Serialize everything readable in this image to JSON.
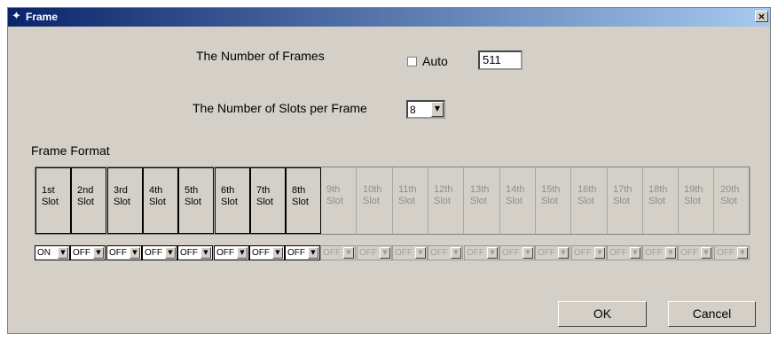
{
  "window": {
    "title": "Frame",
    "close_glyph": "×"
  },
  "frames": {
    "label": "The Number of Frames",
    "auto_label": "Auto",
    "auto_checked": false,
    "value": "511"
  },
  "slots_per_frame": {
    "label": "The Number of Slots per Frame",
    "value": "8"
  },
  "frame_format": {
    "label": "Frame Format",
    "slots": [
      {
        "ordinal": "1st",
        "word": "Slot",
        "enabled": true,
        "state": "ON"
      },
      {
        "ordinal": "2nd",
        "word": "Slot",
        "enabled": true,
        "state": "OFF"
      },
      {
        "ordinal": "3rd",
        "word": "Slot",
        "enabled": true,
        "state": "OFF"
      },
      {
        "ordinal": "4th",
        "word": "Slot",
        "enabled": true,
        "state": "OFF"
      },
      {
        "ordinal": "5th",
        "word": "Slot",
        "enabled": true,
        "state": "OFF"
      },
      {
        "ordinal": "6th",
        "word": "Slot",
        "enabled": true,
        "state": "OFF"
      },
      {
        "ordinal": "7th",
        "word": "Slot",
        "enabled": true,
        "state": "OFF"
      },
      {
        "ordinal": "8th",
        "word": "Slot",
        "enabled": true,
        "state": "OFF"
      },
      {
        "ordinal": "9th",
        "word": "Slot",
        "enabled": false,
        "state": "OFF"
      },
      {
        "ordinal": "10th",
        "word": "Slot",
        "enabled": false,
        "state": "OFF"
      },
      {
        "ordinal": "11th",
        "word": "Slot",
        "enabled": false,
        "state": "OFF"
      },
      {
        "ordinal": "12th",
        "word": "Slot",
        "enabled": false,
        "state": "OFF"
      },
      {
        "ordinal": "13th",
        "word": "Slot",
        "enabled": false,
        "state": "OFF"
      },
      {
        "ordinal": "14th",
        "word": "Slot",
        "enabled": false,
        "state": "OFF"
      },
      {
        "ordinal": "15th",
        "word": "Slot",
        "enabled": false,
        "state": "OFF"
      },
      {
        "ordinal": "16th",
        "word": "Slot",
        "enabled": false,
        "state": "OFF"
      },
      {
        "ordinal": "17th",
        "word": "Slot",
        "enabled": false,
        "state": "OFF"
      },
      {
        "ordinal": "18th",
        "word": "Slot",
        "enabled": false,
        "state": "OFF"
      },
      {
        "ordinal": "19th",
        "word": "Slot",
        "enabled": false,
        "state": "OFF"
      },
      {
        "ordinal": "20th",
        "word": "Slot",
        "enabled": false,
        "state": "OFF"
      }
    ]
  },
  "buttons": {
    "ok": "OK",
    "cancel": "Cancel"
  },
  "colors": {
    "title_bar_start": "#0a246a",
    "title_bar_end": "#a6caf0",
    "dialog_bg": "#d4d0c8",
    "disabled_text": "#8e8e8e"
  },
  "icons": {
    "title": "app-icon",
    "close": "close-icon",
    "dropdown": "chevron-down-icon"
  }
}
